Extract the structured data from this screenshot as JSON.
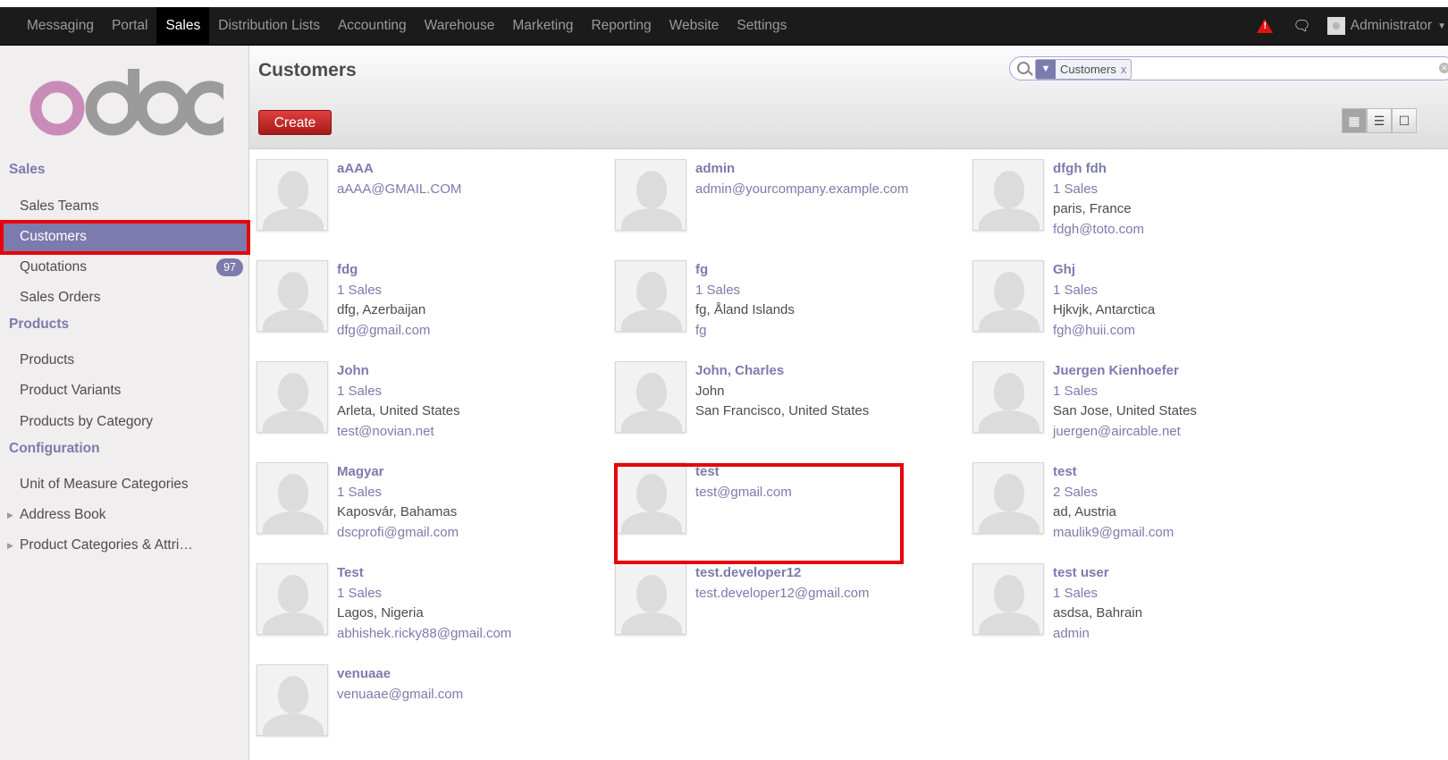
{
  "topbar": {
    "menu": [
      "Messaging",
      "Portal",
      "Sales",
      "Distribution Lists",
      "Accounting",
      "Warehouse",
      "Marketing",
      "Reporting",
      "Website",
      "Settings"
    ],
    "active": "Sales",
    "user": "Administrator"
  },
  "logo_text": "odoo",
  "sidebar": {
    "sections": [
      {
        "title": "Sales",
        "items": [
          {
            "label": "Sales Teams"
          },
          {
            "label": "Customers",
            "active": true
          },
          {
            "label": "Quotations",
            "badge": "97"
          },
          {
            "label": "Sales Orders"
          }
        ]
      },
      {
        "title": "Products",
        "items": [
          {
            "label": "Products"
          },
          {
            "label": "Product Variants"
          },
          {
            "label": "Products by Category"
          }
        ]
      },
      {
        "title": "Configuration",
        "items": [
          {
            "label": "Unit of Measure Categories"
          },
          {
            "label": "Address Book",
            "collapsed": true
          },
          {
            "label": "Product Categories & Attri…",
            "collapsed": true
          }
        ]
      }
    ]
  },
  "header": {
    "title": "Customers",
    "create_label": "Create",
    "facet_label": "Customers",
    "facet_remove": "x"
  },
  "customers": [
    {
      "name": "aAAA",
      "lines": [
        {
          "text": "aAAA@GMAIL.COM",
          "kind": "link"
        }
      ]
    },
    {
      "name": "admin",
      "lines": [
        {
          "text": "admin@yourcompany.example.com",
          "kind": "link"
        }
      ]
    },
    {
      "name": "dfgh fdh",
      "lines": [
        {
          "text": "1 Sales",
          "kind": "link"
        },
        {
          "text": "paris, France",
          "kind": "text"
        },
        {
          "text": "fdgh@toto.com",
          "kind": "link"
        }
      ]
    },
    {
      "name": "fdg",
      "lines": [
        {
          "text": "1 Sales",
          "kind": "link"
        },
        {
          "text": "dfg, Azerbaijan",
          "kind": "text"
        },
        {
          "text": "dfg@gmail.com",
          "kind": "link"
        }
      ]
    },
    {
      "name": "fg",
      "lines": [
        {
          "text": "1 Sales",
          "kind": "link"
        },
        {
          "text": "fg, Åland Islands",
          "kind": "text"
        },
        {
          "text": "fg",
          "kind": "link"
        }
      ]
    },
    {
      "name": "Ghj",
      "lines": [
        {
          "text": "1 Sales",
          "kind": "link"
        },
        {
          "text": "Hjkvjk, Antarctica",
          "kind": "text"
        },
        {
          "text": "fgh@huii.com",
          "kind": "link"
        }
      ]
    },
    {
      "name": "John",
      "lines": [
        {
          "text": "1 Sales",
          "kind": "link"
        },
        {
          "text": "Arleta, United States",
          "kind": "text"
        },
        {
          "text": "test@novian.net",
          "kind": "link"
        }
      ]
    },
    {
      "name": "John, Charles",
      "lines": [
        {
          "text": "John",
          "kind": "text"
        },
        {
          "text": "San Francisco, United States",
          "kind": "text"
        }
      ]
    },
    {
      "name": "Juergen Kienhoefer",
      "lines": [
        {
          "text": "1 Sales",
          "kind": "link"
        },
        {
          "text": "San Jose, United States",
          "kind": "text"
        },
        {
          "text": "juergen@aircable.net",
          "kind": "link"
        }
      ]
    },
    {
      "name": "Magyar",
      "lines": [
        {
          "text": "1 Sales",
          "kind": "link"
        },
        {
          "text": "Kaposvár, Bahamas",
          "kind": "text"
        },
        {
          "text": "dscprofi@gmail.com",
          "kind": "link"
        }
      ]
    },
    {
      "name": "test",
      "lines": [
        {
          "text": "test@gmail.com",
          "kind": "link"
        }
      ],
      "highlighted": true
    },
    {
      "name": "test",
      "lines": [
        {
          "text": "2 Sales",
          "kind": "link"
        },
        {
          "text": "ad, Austria",
          "kind": "text"
        },
        {
          "text": "maulik9@gmail.com",
          "kind": "link"
        }
      ]
    },
    {
      "name": "Test",
      "lines": [
        {
          "text": "1 Sales",
          "kind": "link"
        },
        {
          "text": "Lagos, Nigeria",
          "kind": "text"
        },
        {
          "text": "abhishek.ricky88@gmail.com",
          "kind": "link"
        }
      ]
    },
    {
      "name": "test.developer12",
      "lines": [
        {
          "text": "test.developer12@gmail.com",
          "kind": "link"
        }
      ]
    },
    {
      "name": "test user",
      "lines": [
        {
          "text": "1 Sales",
          "kind": "link"
        },
        {
          "text": "asdsa, Bahrain",
          "kind": "text"
        },
        {
          "text": "admin",
          "kind": "link"
        }
      ]
    },
    {
      "name": "venuaae",
      "lines": [
        {
          "text": "venuaae@gmail.com",
          "kind": "link"
        }
      ]
    }
  ],
  "colors": {
    "accent": "#7c7bad",
    "create": "#c42424",
    "highlight": "#e8000b",
    "topbar": "#1b1b1b"
  }
}
